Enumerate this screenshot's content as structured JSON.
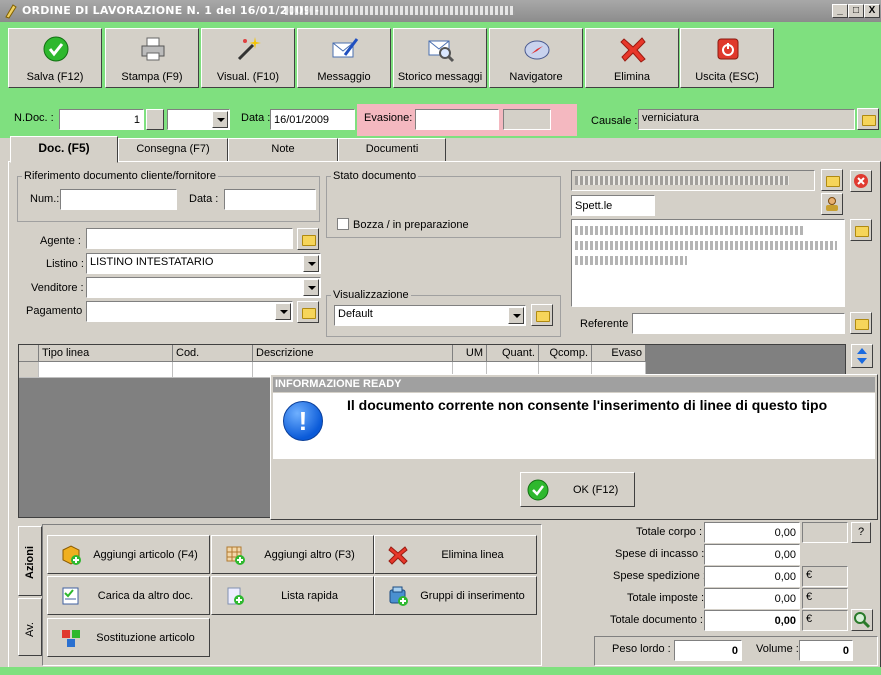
{
  "window": {
    "title": "ORDINE DI LAVORAZIONE N. 1  del 16/01/2009 -",
    "min": "_",
    "max": "□",
    "close": "X"
  },
  "toolbar": [
    {
      "label": "Salva (F12)",
      "icon": "save-check-icon"
    },
    {
      "label": "Stampa (F9)",
      "icon": "printer-icon"
    },
    {
      "label": "Visual. (F10)",
      "icon": "magic-wand-icon"
    },
    {
      "label": "Messaggio",
      "icon": "envelope-pen-icon"
    },
    {
      "label": "Storico messaggi",
      "icon": "envelope-search-icon"
    },
    {
      "label": "Navigatore",
      "icon": "compass-icon"
    },
    {
      "label": "Elimina",
      "icon": "delete-x-icon"
    },
    {
      "label": "Uscita (ESC)",
      "icon": "power-icon"
    }
  ],
  "header": {
    "ndoc_label": "N.Doc. :",
    "ndoc_value": "1",
    "data_label": "Data :",
    "data_value": "16/01/2009",
    "evasione_label": "Evasione:",
    "evasione_value": "",
    "causale_label": "Causale :",
    "causale_value": "verniciatura"
  },
  "tabs": [
    "Doc. (F5)",
    "Consegna (F7)",
    "Note",
    "Documenti"
  ],
  "riferimento": {
    "legend": "Riferimento documento cliente/fornitore",
    "num_label": "Num.:",
    "data_label": "Data :"
  },
  "stato": {
    "legend": "Stato documento",
    "bozza_label": "Bozza / in preparazione"
  },
  "fields": {
    "agente_label": "Agente :",
    "listino_label": "Listino :",
    "listino_value": "LISTINO INTESTATARIO",
    "venditore_label": "Venditore :",
    "pagamento_label": "Pagamento :"
  },
  "visualizzazione": {
    "legend": "Visualizzazione",
    "value": "Default"
  },
  "cliente": {
    "title_value": "Spett.le",
    "referente_label": "Referente"
  },
  "grid": {
    "columns": [
      "Tipo linea",
      "Cod.",
      "Descrizione",
      "UM",
      "Quant.",
      "Qcomp.",
      "Evaso"
    ]
  },
  "dialog": {
    "caption": "INFORMAZIONE READY",
    "message": "Il documento corrente non consente l'inserimento di linee di questo tipo",
    "ok_label": "OK (F12)"
  },
  "side_tabs": [
    "Azioni",
    "Av."
  ],
  "actions": [
    {
      "label": "Aggiungi articolo (F4)",
      "icon": "add-article-icon"
    },
    {
      "label": "Aggiungi altro (F3)",
      "icon": "add-other-icon"
    },
    {
      "label": "Elimina linea",
      "icon": "delete-line-icon"
    },
    {
      "label": "Carica da altro doc.",
      "icon": "load-document-icon"
    },
    {
      "label": "Lista rapida",
      "icon": "quick-list-icon"
    },
    {
      "label": "Gruppi di inserimento",
      "icon": "insert-group-icon"
    },
    {
      "label": "Sostituzione articolo",
      "icon": "replace-article-icon"
    }
  ],
  "totals": {
    "corpo_label": "Totale corpo :",
    "corpo_value": "0,00",
    "incasso_label": "Spese di incasso :",
    "incasso_value": "0,00",
    "spedizione_label": "Spese spedizione :",
    "spedizione_value": "0,00",
    "imposte_label": "Totale imposte :",
    "imposte_value": "0,00",
    "documento_label": "Totale documento :",
    "documento_value": "0,00",
    "currency": "€",
    "help_label": "?",
    "peso_label": "Peso lordo :",
    "peso_value": "0",
    "volume_label": "Volume :",
    "volume_value": "0"
  },
  "colors": {
    "accent_green": "#7fe07f",
    "evasione_pink": "#f4b8c0",
    "dialog_caption": "#a0a0a0"
  }
}
